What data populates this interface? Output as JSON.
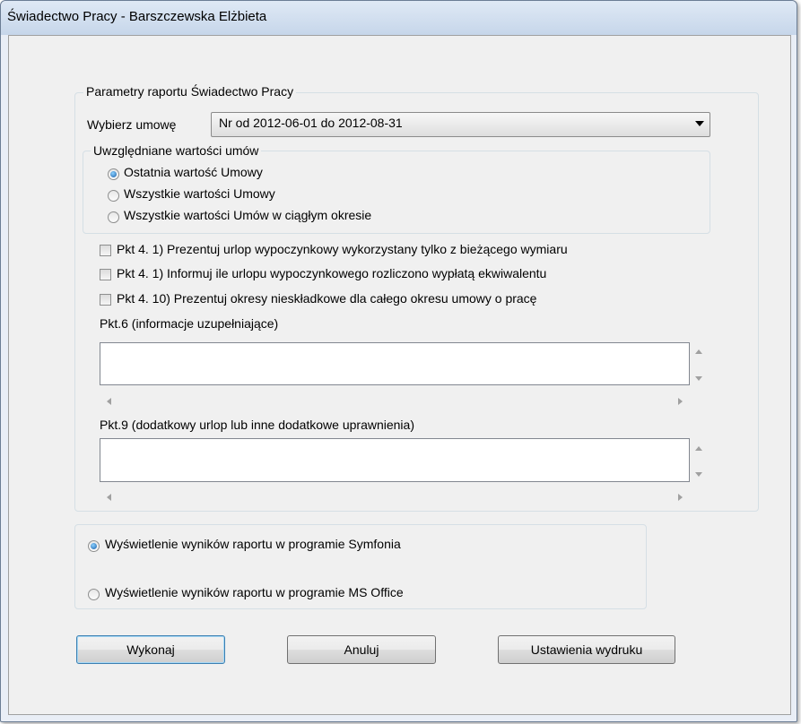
{
  "window": {
    "title": "Świadectwo Pracy - Barszczewska Elżbieta"
  },
  "params": {
    "group_label": "Parametry raportu  Świadectwo Pracy",
    "contract_label": "Wybierz umowę",
    "contract_value": "Nr  od 2012-06-01 do 2012-08-31",
    "values_group": {
      "label": "Uwzględniane wartości umów",
      "options": [
        {
          "label": "Ostatnia wartość Umowy",
          "checked": true
        },
        {
          "label": "Wszystkie wartości Umowy",
          "checked": false
        },
        {
          "label": "Wszystkie wartości Umów w ciągłym okresie",
          "checked": false
        }
      ]
    },
    "checkboxes": [
      {
        "label": "Pkt 4. 1) Prezentuj urlop wypoczynkowy wykorzystany tylko z bieżącego wymiaru",
        "checked": false
      },
      {
        "label": "Pkt 4. 1) Informuj ile urlopu wypoczynkowego rozliczono wypłatą ekwiwalentu",
        "checked": false
      },
      {
        "label": "Pkt 4. 10) Prezentuj okresy nieskładkowe dla całego okresu umowy o pracę",
        "checked": false
      }
    ],
    "pkt6": {
      "label": "Pkt.6 (informacje uzupełniające)",
      "value": ""
    },
    "pkt9": {
      "label": "Pkt.9 (dodatkowy urlop lub inne dodatkowe uprawnienia)",
      "value": ""
    }
  },
  "output": {
    "options": [
      {
        "label": "Wyświetlenie wyników raportu w programie Symfonia",
        "checked": true
      },
      {
        "label": "Wyświetlenie wyników raportu w programie MS Office",
        "checked": false
      }
    ]
  },
  "buttons": {
    "execute": "Wykonaj",
    "cancel": "Anuluj",
    "print_settings": "Ustawienia wydruku"
  }
}
